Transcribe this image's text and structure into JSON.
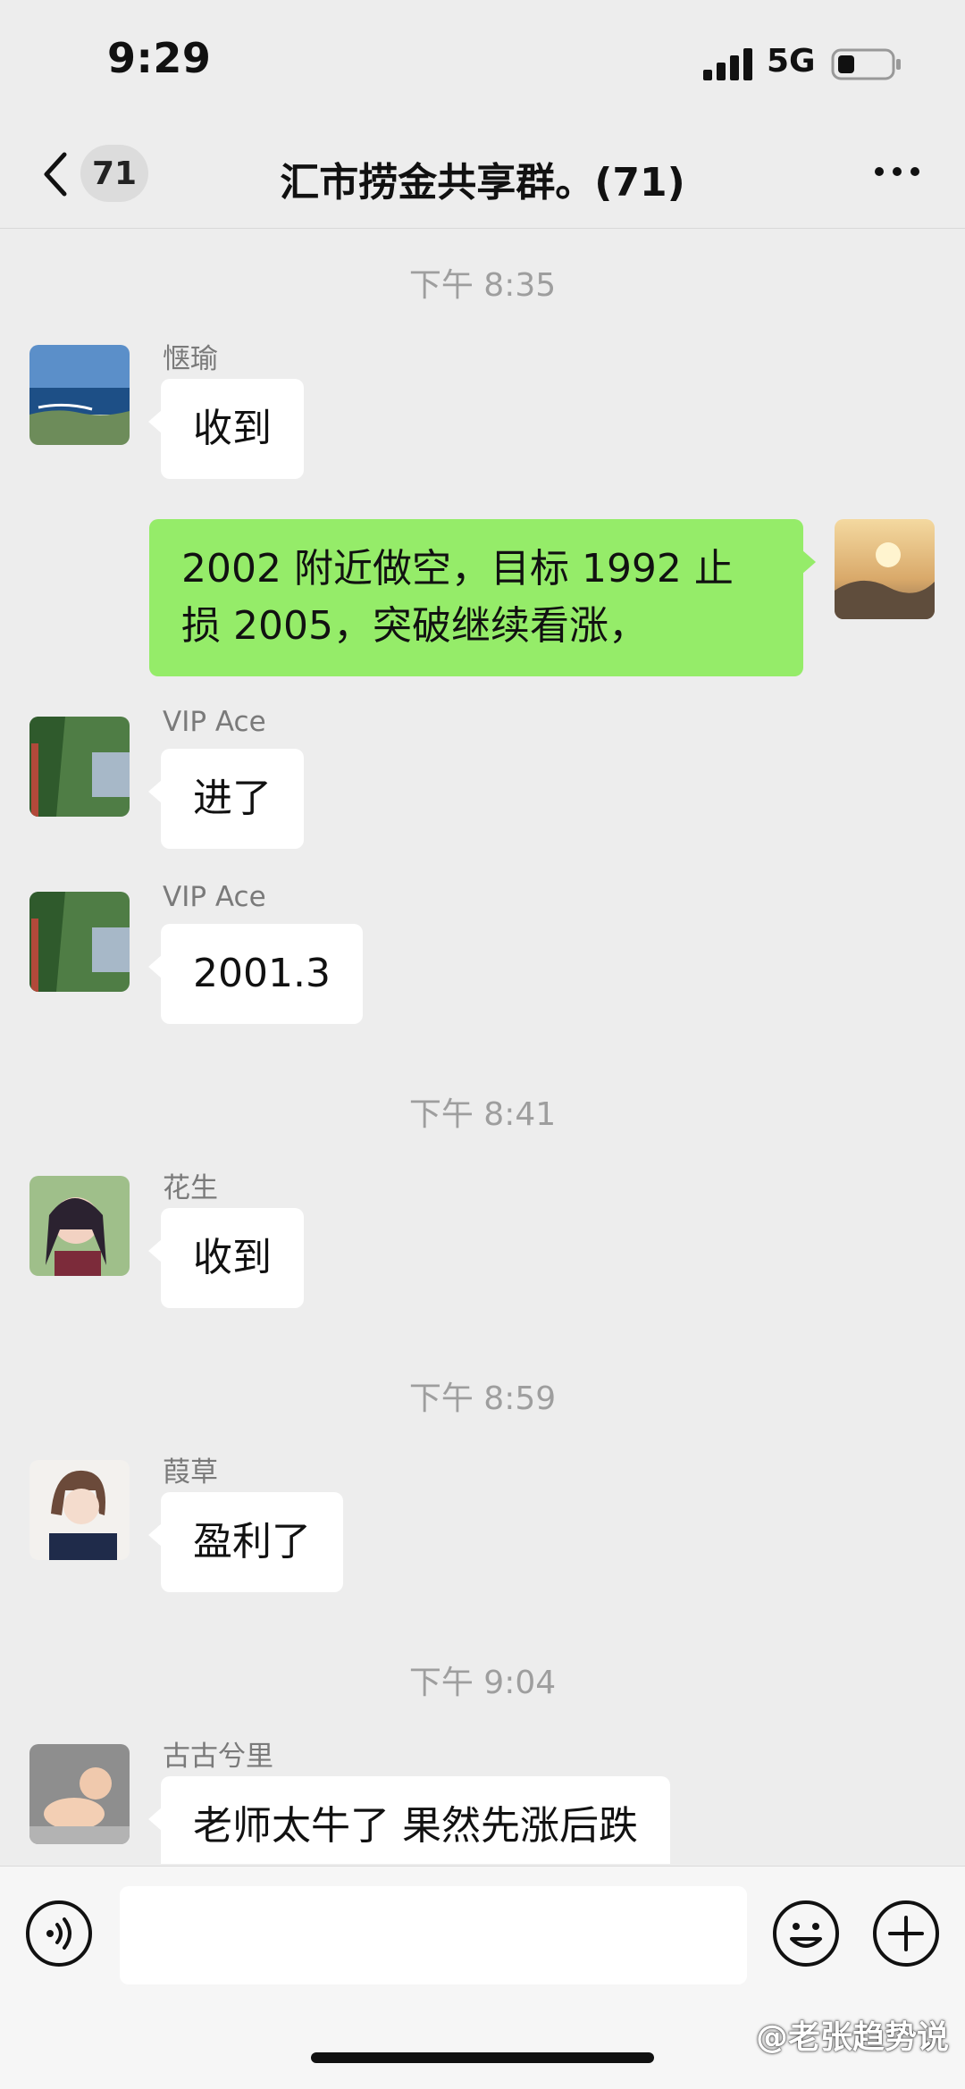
{
  "status_bar": {
    "time": "9:29",
    "network": "5G",
    "icons": [
      "signal-icon",
      "battery-icon"
    ]
  },
  "header": {
    "back_icon": "chevron-left-icon",
    "unread_count": "71",
    "title": "汇市捞金共享群。(71)",
    "more_icon": "more-dots-icon"
  },
  "messages": [
    {
      "kind": "timestamp",
      "text": "下午 8:35"
    },
    {
      "kind": "incoming",
      "sender": "惬瑜",
      "text": "收到",
      "avatar": "ocean-scene"
    },
    {
      "kind": "outgoing",
      "text": "2002 附近做空，目标 1992 止损 2005，突破继续看涨，",
      "avatar": "sunset-mountains"
    },
    {
      "kind": "incoming",
      "sender": "VIP Ace",
      "text": "进了",
      "avatar": "green-trees"
    },
    {
      "kind": "incoming",
      "sender": "VIP Ace",
      "text": "2001.3",
      "avatar": "green-trees"
    },
    {
      "kind": "timestamp",
      "text": "下午 8:41"
    },
    {
      "kind": "incoming",
      "sender": "花生",
      "text": "收到",
      "avatar": "anime-girl"
    },
    {
      "kind": "timestamp",
      "text": "下午 8:59"
    },
    {
      "kind": "incoming",
      "sender": "葭草",
      "text": "盈利了",
      "avatar": "illustrated-girl"
    },
    {
      "kind": "timestamp",
      "text": "下午 9:04"
    },
    {
      "kind": "incoming",
      "sender": "古古兮里",
      "text": "老师太牛了 果然先涨后跌",
      "avatar": "baby-photo"
    }
  ],
  "input_bar": {
    "value": "",
    "voice_icon": "voice-icon",
    "emoji_icon": "emoji-icon",
    "plus_icon": "plus-icon"
  },
  "watermark": "@老张趋势说",
  "colors": {
    "background": "#ededed",
    "outgoing_bubble": "#95ec69",
    "incoming_bubble": "#ffffff",
    "timestamp_text": "#9e9e9e",
    "sender_text": "#7a7a7a"
  }
}
